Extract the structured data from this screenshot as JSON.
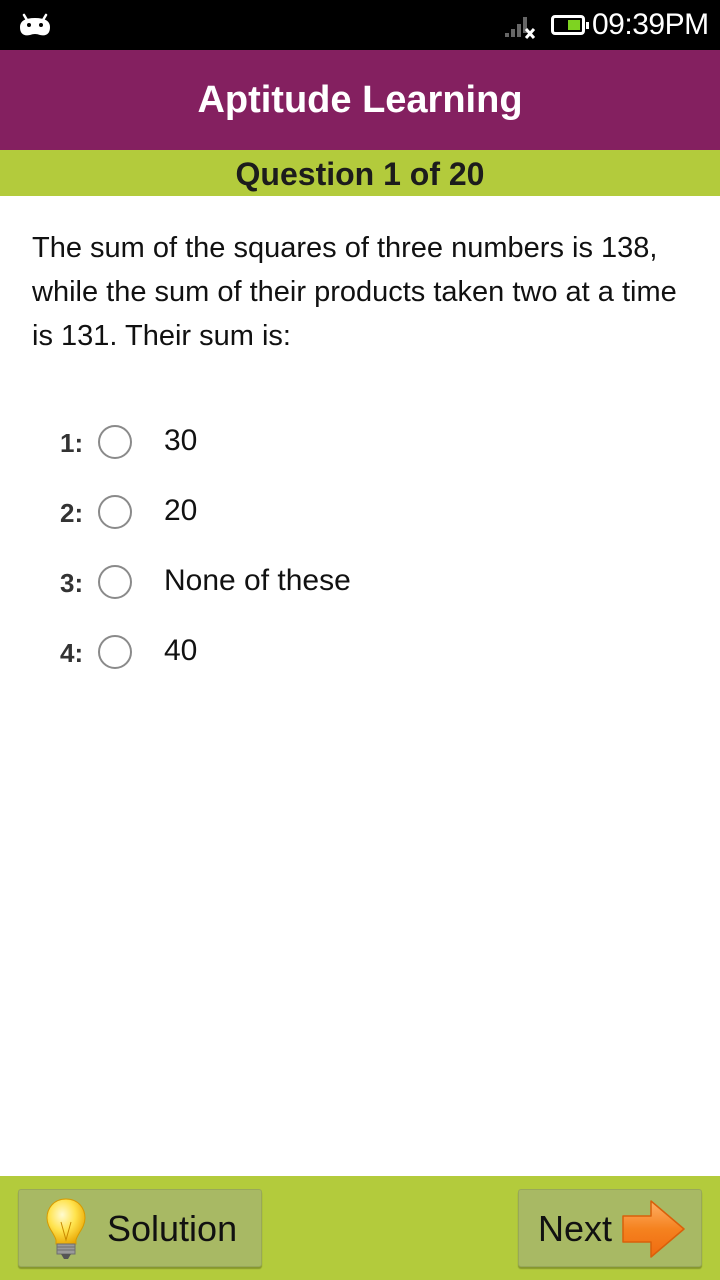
{
  "status_bar": {
    "notification_icon": "android-icon",
    "signal_icon": "signal-no-service-icon",
    "battery_icon": "battery-icon",
    "time": "09:39PM"
  },
  "app_bar": {
    "title": "Aptitude Learning"
  },
  "question_header": {
    "label": "Question 1 of 20",
    "current": 1,
    "total": 20
  },
  "question": {
    "text": "The sum of the squares of three numbers is 138, while the sum of their products taken two at a time is 131. Their sum is:"
  },
  "options": [
    {
      "number": "1:",
      "text": "30",
      "selected": false
    },
    {
      "number": "2:",
      "text": "20",
      "selected": false
    },
    {
      "number": "3:",
      "text": "None of these",
      "selected": false
    },
    {
      "number": "4:",
      "text": "40",
      "selected": false
    }
  ],
  "bottom_bar": {
    "solution_label": "Solution",
    "solution_icon": "lightbulb-icon",
    "next_label": "Next",
    "next_icon": "arrow-right-icon"
  },
  "colors": {
    "app_bar": "#842060",
    "accent_bar": "#b3cb3c",
    "button": "#a8b964",
    "battery_fill": "#7ed321",
    "arrow": "#f5821f"
  }
}
